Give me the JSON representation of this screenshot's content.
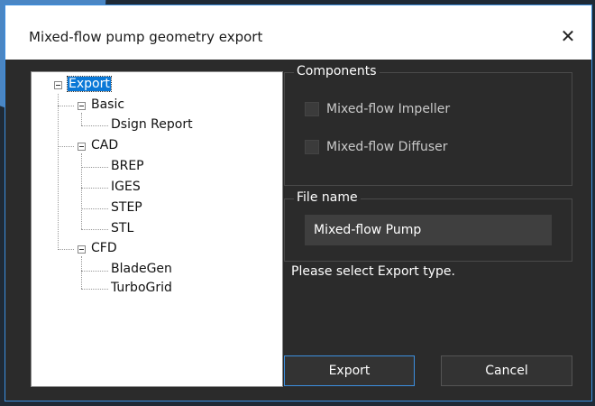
{
  "window": {
    "title": "Mixed-flow pump geometry export",
    "close_glyph": "✕"
  },
  "tree": {
    "root": "Export",
    "groups": [
      {
        "label": "Basic",
        "children": [
          "Dsign Report"
        ]
      },
      {
        "label": "CAD",
        "children": [
          "BREP",
          "IGES",
          "STEP",
          "STL"
        ]
      },
      {
        "label": "CFD",
        "children": [
          "BladeGen",
          "TurboGrid"
        ]
      }
    ]
  },
  "components": {
    "title": "Components",
    "items": [
      {
        "label": "Mixed-flow Impeller",
        "checked": false
      },
      {
        "label": "Mixed-flow Diffuser",
        "checked": false
      }
    ]
  },
  "filename": {
    "title": "File name",
    "value": "Mixed-flow Pump"
  },
  "status": "Please select Export type.",
  "buttons": {
    "export": "Export",
    "cancel": "Cancel"
  },
  "colors": {
    "accent": "#3c8fe0",
    "selection": "#0a78d7",
    "background": "#2b2b2b"
  }
}
